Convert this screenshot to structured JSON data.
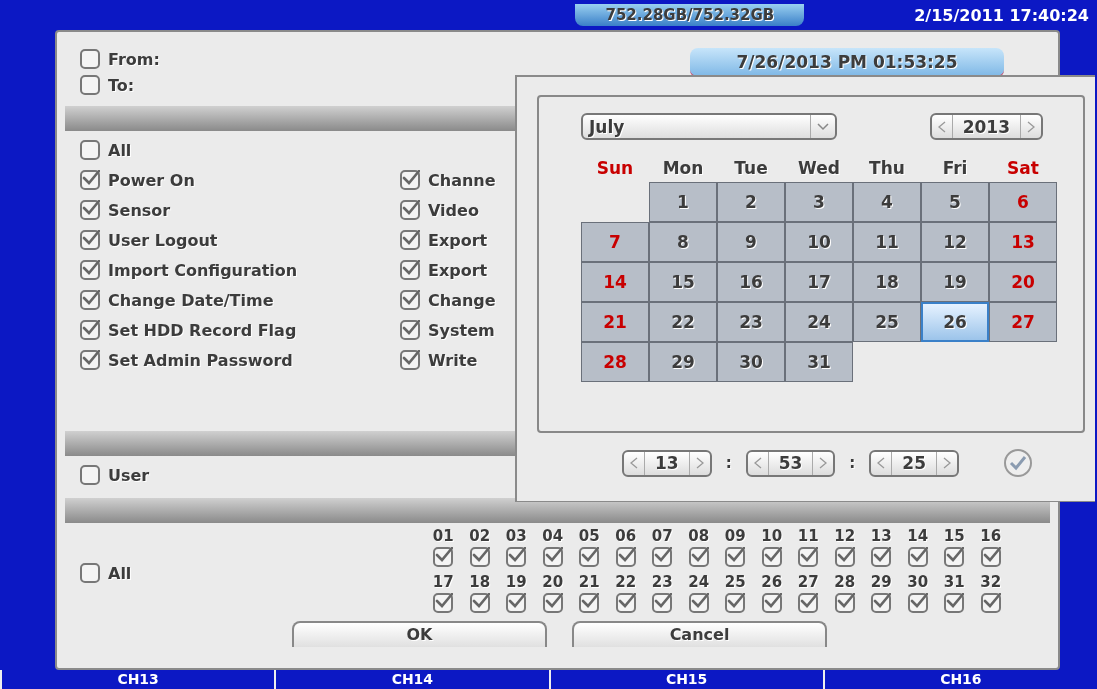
{
  "top_bar": {
    "storage": "752.28GB/752.32GB",
    "clock": "2/15/2011 17:40:24"
  },
  "channel_labels": [
    "CH13",
    "CH14",
    "CH15",
    "CH16"
  ],
  "dialog": {
    "from": {
      "label": "From:",
      "checked": false
    },
    "to": {
      "label": "To:",
      "checked": false
    },
    "datetime": "7/26/2013 PM 01:53:25",
    "events": {
      "all": {
        "label": "All",
        "checked": false
      },
      "left_column": [
        {
          "label": "Power On",
          "checked": true
        },
        {
          "label": "Sensor",
          "checked": true
        },
        {
          "label": "User Logout",
          "checked": true
        },
        {
          "label": "Import Configuration",
          "checked": true
        },
        {
          "label": "Change Date/Time",
          "checked": true
        },
        {
          "label": "Set HDD Record Flag",
          "checked": true
        },
        {
          "label": "Set Admin Password",
          "checked": true
        }
      ],
      "right_column": [
        {
          "label": "Channe",
          "checked": true
        },
        {
          "label": "Video",
          "checked": true
        },
        {
          "label": "Export",
          "checked": true
        },
        {
          "label": "Export",
          "checked": true
        },
        {
          "label": "Change",
          "checked": true
        },
        {
          "label": "System",
          "checked": true
        },
        {
          "label": "Write",
          "checked": true
        }
      ]
    },
    "user": {
      "label": "User",
      "checked": false
    },
    "channels": {
      "all": {
        "label": "All",
        "checked": false
      },
      "items": [
        {
          "number": "01",
          "checked": true
        },
        {
          "number": "02",
          "checked": true
        },
        {
          "number": "03",
          "checked": true
        },
        {
          "number": "04",
          "checked": true
        },
        {
          "number": "05",
          "checked": true
        },
        {
          "number": "06",
          "checked": true
        },
        {
          "number": "07",
          "checked": true
        },
        {
          "number": "08",
          "checked": true
        },
        {
          "number": "09",
          "checked": true
        },
        {
          "number": "10",
          "checked": true
        },
        {
          "number": "11",
          "checked": true
        },
        {
          "number": "12",
          "checked": true
        },
        {
          "number": "13",
          "checked": true
        },
        {
          "number": "14",
          "checked": true
        },
        {
          "number": "15",
          "checked": true
        },
        {
          "number": "16",
          "checked": true
        },
        {
          "number": "17",
          "checked": true
        },
        {
          "number": "18",
          "checked": true
        },
        {
          "number": "19",
          "checked": true
        },
        {
          "number": "20",
          "checked": true
        },
        {
          "number": "21",
          "checked": true
        },
        {
          "number": "22",
          "checked": true
        },
        {
          "number": "23",
          "checked": true
        },
        {
          "number": "24",
          "checked": true
        },
        {
          "number": "25",
          "checked": true
        },
        {
          "number": "26",
          "checked": true
        },
        {
          "number": "27",
          "checked": true
        },
        {
          "number": "28",
          "checked": true
        },
        {
          "number": "29",
          "checked": true
        },
        {
          "number": "30",
          "checked": true
        },
        {
          "number": "31",
          "checked": true
        },
        {
          "number": "32",
          "checked": true
        }
      ]
    },
    "buttons": [
      "OK",
      "Cancel"
    ]
  },
  "calendar": {
    "month": "July",
    "year": "2013",
    "weekdays": [
      {
        "label": "Sun",
        "weekend": true
      },
      {
        "label": "Mon",
        "weekend": false
      },
      {
        "label": "Tue",
        "weekend": false
      },
      {
        "label": "Wed",
        "weekend": false
      },
      {
        "label": "Thu",
        "weekend": false
      },
      {
        "label": "Fri",
        "weekend": false
      },
      {
        "label": "Sat",
        "weekend": true
      }
    ],
    "weeks": [
      [
        {
          "kind": "empty"
        },
        {
          "kind": "day",
          "label": "1",
          "weekend": false,
          "selected": false
        },
        {
          "kind": "day",
          "label": "2",
          "weekend": false,
          "selected": false
        },
        {
          "kind": "day",
          "label": "3",
          "weekend": false,
          "selected": false
        },
        {
          "kind": "day",
          "label": "4",
          "weekend": false,
          "selected": false
        },
        {
          "kind": "day",
          "label": "5",
          "weekend": false,
          "selected": false
        },
        {
          "kind": "day",
          "label": "6",
          "weekend": true,
          "selected": false
        }
      ],
      [
        {
          "kind": "day",
          "label": "7",
          "weekend": true,
          "selected": false
        },
        {
          "kind": "day",
          "label": "8",
          "weekend": false,
          "selected": false
        },
        {
          "kind": "day",
          "label": "9",
          "weekend": false,
          "selected": false
        },
        {
          "kind": "day",
          "label": "10",
          "weekend": false,
          "selected": false
        },
        {
          "kind": "day",
          "label": "11",
          "weekend": false,
          "selected": false
        },
        {
          "kind": "day",
          "label": "12",
          "weekend": false,
          "selected": false
        },
        {
          "kind": "day",
          "label": "13",
          "weekend": true,
          "selected": false
        }
      ],
      [
        {
          "kind": "day",
          "label": "14",
          "weekend": true,
          "selected": false
        },
        {
          "kind": "day",
          "label": "15",
          "weekend": false,
          "selected": false
        },
        {
          "kind": "day",
          "label": "16",
          "weekend": false,
          "selected": false
        },
        {
          "kind": "day",
          "label": "17",
          "weekend": false,
          "selected": false
        },
        {
          "kind": "day",
          "label": "18",
          "weekend": false,
          "selected": false
        },
        {
          "kind": "day",
          "label": "19",
          "weekend": false,
          "selected": false
        },
        {
          "kind": "day",
          "label": "20",
          "weekend": true,
          "selected": false
        }
      ],
      [
        {
          "kind": "day",
          "label": "21",
          "weekend": true,
          "selected": false
        },
        {
          "kind": "day",
          "label": "22",
          "weekend": false,
          "selected": false
        },
        {
          "kind": "day",
          "label": "23",
          "weekend": false,
          "selected": false
        },
        {
          "kind": "day",
          "label": "24",
          "weekend": false,
          "selected": false
        },
        {
          "kind": "day",
          "label": "25",
          "weekend": false,
          "selected": false
        },
        {
          "kind": "day",
          "label": "26",
          "weekend": false,
          "selected": true
        },
        {
          "kind": "day",
          "label": "27",
          "weekend": true,
          "selected": false
        }
      ],
      [
        {
          "kind": "day",
          "label": "28",
          "weekend": true,
          "selected": false
        },
        {
          "kind": "day",
          "label": "29",
          "weekend": false,
          "selected": false
        },
        {
          "kind": "day",
          "label": "30",
          "weekend": false,
          "selected": false
        },
        {
          "kind": "day",
          "label": "31",
          "weekend": false,
          "selected": false
        }
      ]
    ],
    "time": [
      "13",
      "53",
      "25"
    ],
    "separators": [
      ":",
      ":"
    ]
  }
}
